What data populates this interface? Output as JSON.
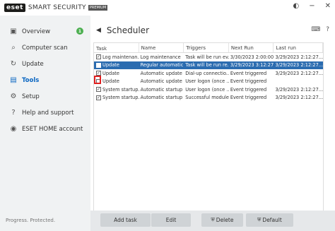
{
  "app": {
    "logo": "eset",
    "product": "SMART SECURITY",
    "edition": "PREMIUM"
  },
  "titlebar_icons": [
    "contrast-icon",
    "minimize-icon",
    "close-icon"
  ],
  "sidebar": {
    "items": [
      {
        "label": "Overview",
        "icon": "shield-icon",
        "badge": "1"
      },
      {
        "label": "Computer scan",
        "icon": "search-icon"
      },
      {
        "label": "Update",
        "icon": "refresh-icon"
      },
      {
        "label": "Tools",
        "icon": "briefcase-icon",
        "active": true
      },
      {
        "label": "Setup",
        "icon": "gear-icon"
      },
      {
        "label": "Help and support",
        "icon": "help-icon"
      },
      {
        "label": "ESET HOME account",
        "icon": "home-account-icon"
      }
    ],
    "status": "Progress. Protected."
  },
  "page": {
    "title": "Scheduler",
    "back_icon": "back-arrow-icon",
    "head_icons": [
      "keyboard-icon",
      "help-icon"
    ]
  },
  "table": {
    "columns": [
      "Task",
      "Name",
      "Triggers",
      "Next Run",
      "Last run"
    ],
    "rows": [
      {
        "checked": true,
        "task": "Log maintenan...",
        "name": "Log maintenance",
        "triggers": "Task will be run ev...",
        "next": "3/30/2023 2:00:00...",
        "last": "3/29/2023 2:12:27..."
      },
      {
        "checked": false,
        "task": "Update",
        "name": "Regular automatic...",
        "triggers": "Task will be run re...",
        "next": "3/29/2023 3:12:27...",
        "last": "3/29/2023 2:12:27...",
        "selected": true
      },
      {
        "checked": true,
        "task": "Update",
        "name": "Automatic update ...",
        "triggers": "Dial-up connectio...",
        "next": "Event triggered",
        "last": "3/29/2023 2:12:27..."
      },
      {
        "checked": false,
        "task": "Update",
        "name": "Automatic update ...",
        "triggers": "User logon (once ...",
        "next": "Event triggered",
        "last": ""
      },
      {
        "checked": true,
        "task": "System startup...",
        "name": "Automatic startup ...",
        "triggers": "User logon (once ...",
        "next": "Event triggered",
        "last": "3/29/2023 2:12:27..."
      },
      {
        "checked": true,
        "task": "System startup...",
        "name": "Automatic startup ...",
        "triggers": "Successful module...",
        "next": "Event triggered",
        "last": "3/29/2023 2:12:27..."
      }
    ]
  },
  "buttons": {
    "add": "Add task",
    "edit": "Edit",
    "delete": "Delete",
    "default": "Default"
  }
}
